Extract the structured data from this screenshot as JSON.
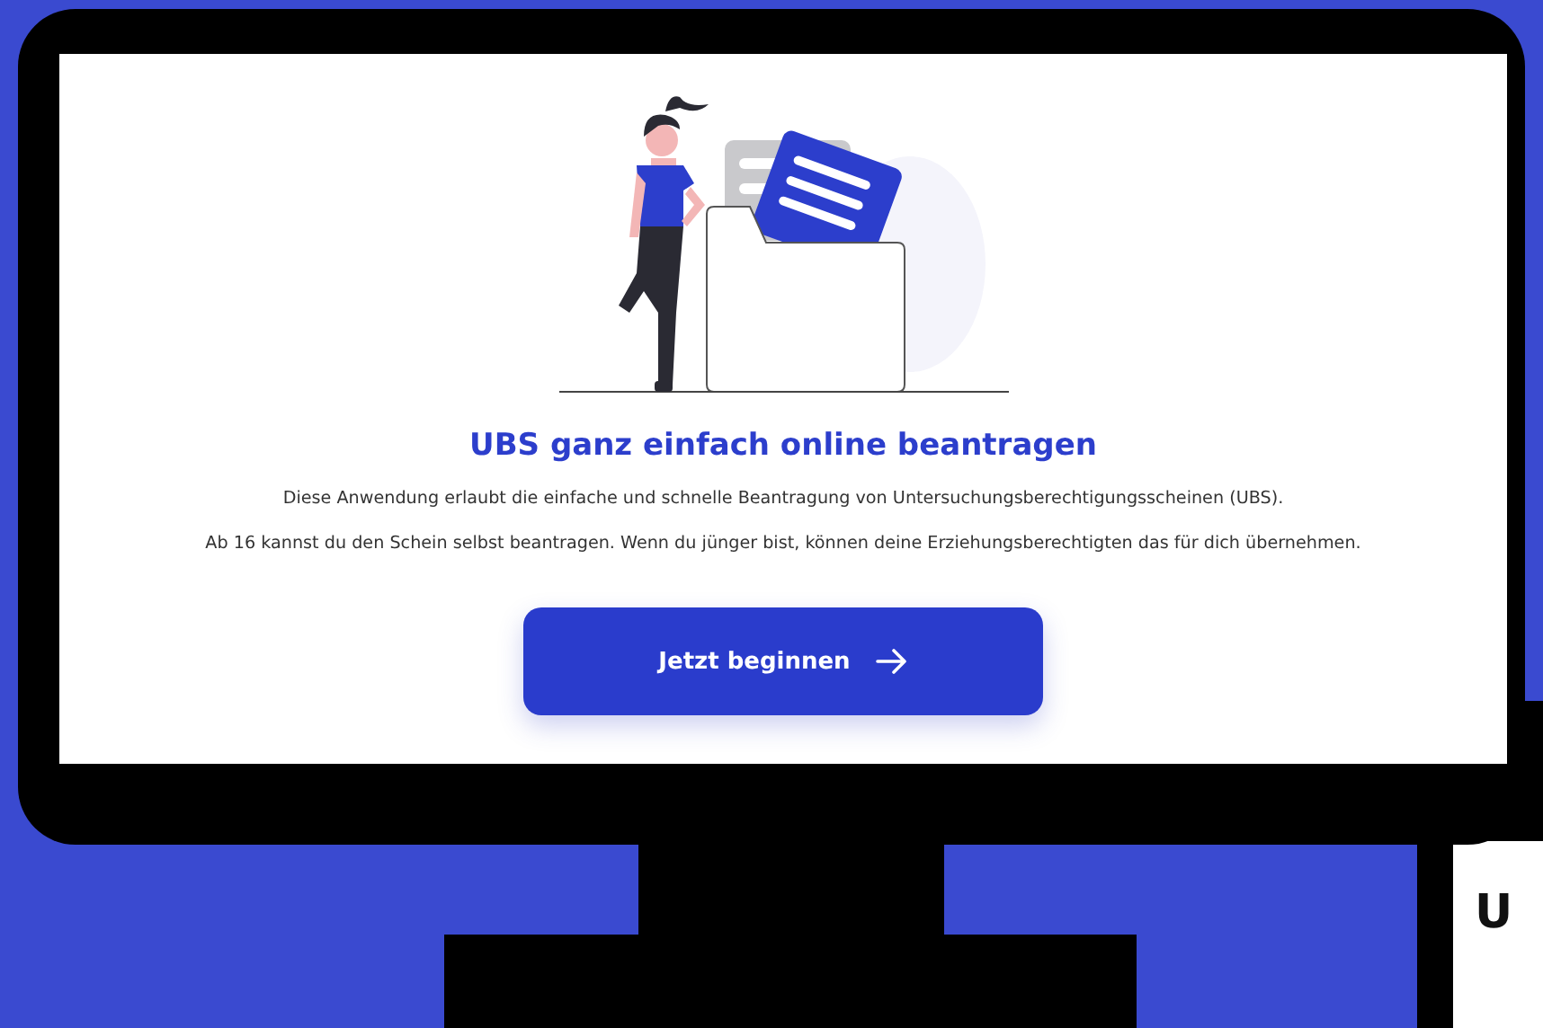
{
  "screen": {
    "heading": "UBS ganz einfach online beantragen",
    "paragraphs": [
      "Diese Anwendung erlaubt die einfache und schnelle Beantragung von Untersuchungsberechtigungsscheinen (UBS).",
      "Ab 16 kannst du den Schein selbst beantragen. Wenn du jünger bist, können deine Erziehungsberechtigten das für dich übernehmen."
    ],
    "button": {
      "label": "Jetzt beginnen"
    }
  },
  "second_device": {
    "heading": "U"
  }
}
